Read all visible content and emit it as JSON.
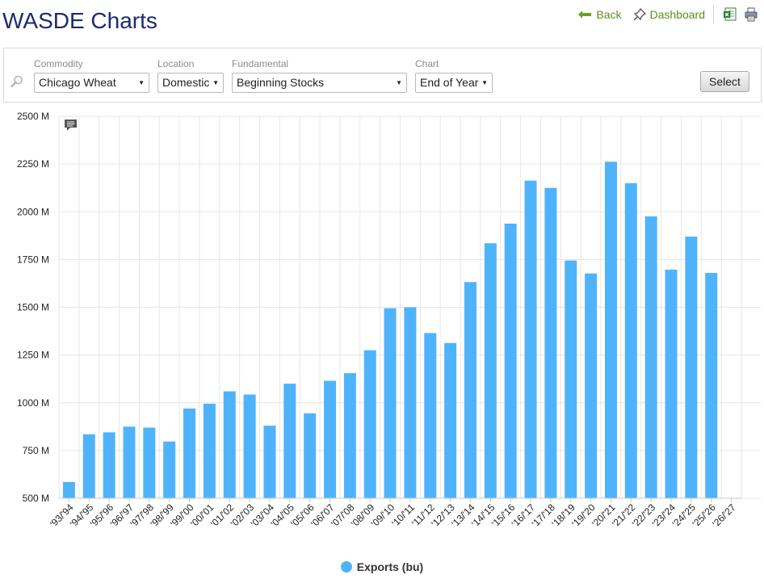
{
  "header": {
    "title": "WASDE Charts",
    "back_label": "Back",
    "dashboard_label": "Dashboard",
    "icons": [
      "back-arrow-icon",
      "pin-icon",
      "excel-export-icon",
      "print-icon"
    ]
  },
  "filters": {
    "search_icon": "magnifier-icon",
    "commodity": {
      "label": "Commodity",
      "value": "Chicago Wheat"
    },
    "location": {
      "label": "Location",
      "value": "Domestic"
    },
    "fundamental": {
      "label": "Fundamental",
      "value": "Beginning Stocks"
    },
    "chart": {
      "label": "Chart",
      "value": "End of Year"
    },
    "select_label": "Select"
  },
  "colors": {
    "bar": "#4fb3fc",
    "grid": "#e6e6e6",
    "title": "#1f2a6b",
    "link": "#5a8f1a"
  },
  "chart_data": {
    "type": "bar",
    "categories": [
      "'93/'94",
      "'94/'95",
      "'95/'96",
      "'96/'97",
      "'97/'98",
      "'98/'99",
      "'99/'00",
      "'00/'01",
      "'01/'02",
      "'02/'03",
      "'03/'04",
      "'04/'05",
      "'05/'06",
      "'06/'07",
      "'07/'08",
      "'08/'09",
      "'09/'10",
      "'10/'11",
      "'11/'12",
      "'12/'13",
      "'13/'14",
      "'14/'15",
      "'15/'16",
      "'16/'17",
      "'17/'18",
      "'18/'19",
      "'19/'20",
      "'20/'21",
      "'21/'22",
      "'22/'23",
      "'23/'24",
      "'24/'25",
      "'25/'26",
      "'26/'27"
    ],
    "series": [
      {
        "name": "Exports (bu)",
        "values": [
          585,
          835,
          845,
          875,
          870,
          797,
          970,
          995,
          1060,
          1043,
          880,
          1100,
          945,
          1115,
          1155,
          1275,
          1495,
          1500,
          1365,
          1313,
          1632,
          1835,
          1938,
          2163,
          2125,
          1745,
          1677,
          2262,
          2150,
          1976,
          1697,
          1870,
          1680,
          null
        ]
      }
    ],
    "y_ticks": [
      "500 M",
      "750 M",
      "1000 M",
      "1250 M",
      "1500 M",
      "1750 M",
      "2000 M",
      "2250 M",
      "2500 M"
    ],
    "ylim": [
      500,
      2500
    ],
    "y_unit": "M",
    "grid": true,
    "legend_position": "bottom-center",
    "annotation_icon": "comment-icon"
  }
}
